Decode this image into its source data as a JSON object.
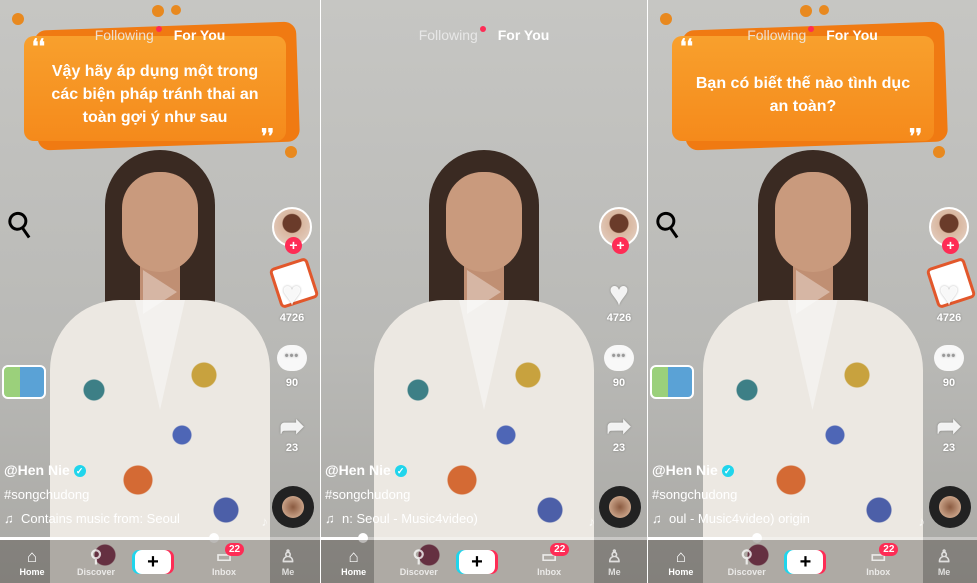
{
  "top_nav": {
    "following": "Following",
    "for_you": "For You"
  },
  "colors": {
    "accent": "#fe2c55",
    "cyan": "#20d5ec",
    "caption_orange": "#f58a1b"
  },
  "panels": [
    {
      "caption": "Vậy hãy áp dụng một trong các biện pháp tránh thai an toàn gợi ý như sau",
      "stickers": [
        "iud-sticker",
        "documents-sticker",
        "condom-sticker"
      ],
      "likes": "4726",
      "comments": "90",
      "shares": "23",
      "username": "@Hen Nie",
      "hashtag": "#songchudong",
      "music": "Contains music from: Seoul",
      "progress": 0.67
    },
    {
      "caption": "",
      "stickers": [],
      "likes": "4726",
      "comments": "90",
      "shares": "23",
      "username": "@Hen Nie",
      "hashtag": "#songchudong",
      "music": "n: Seoul - Music4video)",
      "progress": 0.13
    },
    {
      "caption": "Bạn có biết thế nào tình dục an toàn?",
      "stickers": [
        "iud-sticker",
        "documents-sticker",
        "condom-sticker"
      ],
      "likes": "4726",
      "comments": "90",
      "shares": "23",
      "username": "@Hen Nie",
      "hashtag": "#songchudong",
      "music": "oul - Music4video)   origin",
      "progress": 0.33
    }
  ],
  "tabbar": {
    "home": "Home",
    "discover": "Discover",
    "create": "+",
    "inbox": "Inbox",
    "inbox_badge": "22",
    "me": "Me"
  }
}
